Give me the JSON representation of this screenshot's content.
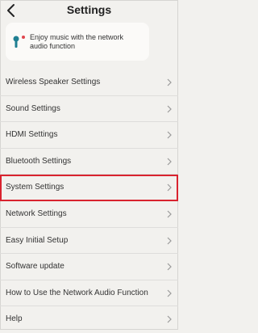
{
  "header": {
    "title": "Settings"
  },
  "banner": {
    "text": "Enjoy music with the network audio function"
  },
  "menu": {
    "items": [
      {
        "label": "Wireless Speaker Settings"
      },
      {
        "label": "Sound Settings"
      },
      {
        "label": "HDMI Settings"
      },
      {
        "label": "Bluetooth Settings"
      },
      {
        "label": "System Settings",
        "highlighted": true
      },
      {
        "label": "Network Settings"
      },
      {
        "label": "Easy Initial Setup"
      },
      {
        "label": "Software update"
      },
      {
        "label": "How to Use the Network Audio Function"
      },
      {
        "label": "Help"
      }
    ]
  },
  "colors": {
    "background": "#f2f1ee",
    "highlight": "#d9232f",
    "banner_red": "#e0464d",
    "banner_teal": "#1f7f92"
  },
  "icons": {
    "back": "chevron-left-icon",
    "row": "chevron-right-icon",
    "banner": "music-note-icon"
  }
}
